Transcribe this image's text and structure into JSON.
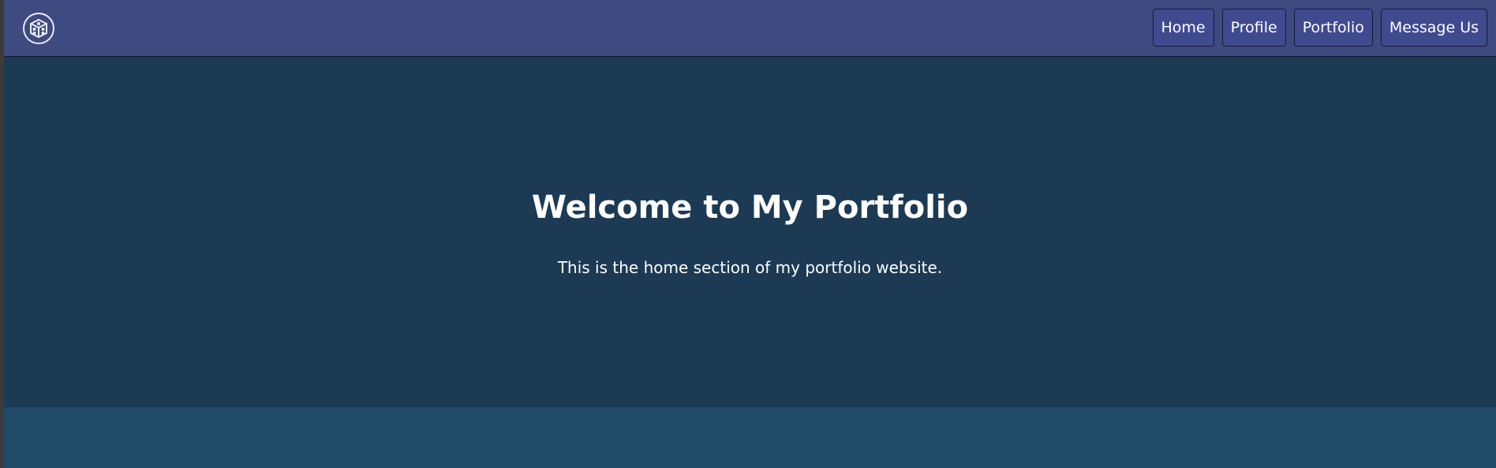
{
  "navbar": {
    "logo_icon": "cube-circle-icon",
    "items": [
      {
        "label": "Home"
      },
      {
        "label": "Profile"
      },
      {
        "label": "Portfolio"
      },
      {
        "label": "Message Us"
      }
    ]
  },
  "hero": {
    "title": "Welcome to My Portfolio",
    "subtitle": "This is the home section of my portfolio website."
  },
  "colors": {
    "navbar_bg": "#3f4a80",
    "nav_button_bg": "#3f4a8f",
    "hero_bg": "#1c3a54",
    "next_section_bg": "#224a69",
    "text": "#ffffff"
  }
}
